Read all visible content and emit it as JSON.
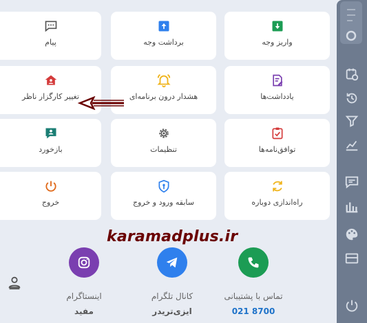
{
  "tiles": {
    "deposit": "واریز وجه",
    "withdraw": "برداشت وجه",
    "message": "پیام",
    "notes": "یادداشت‌ها",
    "in_app_alert": "هشدار درون برنامه‌ای",
    "change_supervisor": "تغییر کارگزار ناظر",
    "agreements": "توافق‌نامه‌ها",
    "settings": "تنظیمات",
    "feedback": "بازخورد",
    "restart": "راه‌اندازی دوباره",
    "login_history": "سابقه ورود و خروج",
    "logout": "خروج"
  },
  "watermark": "karamadplus.ir",
  "contacts": {
    "support_title": "تماس با پشتیبانی",
    "support_phone": "021 8700",
    "telegram_title": "کانال تلگرام",
    "telegram_value": "ایزی‌تریدر",
    "instagram_title": "اینستاگرام",
    "instagram_value": "مفید"
  },
  "colors": {
    "green": "#1c9c54",
    "blue": "#2f80ed",
    "teal": "#1b7e74",
    "red": "#d43b3b",
    "orange": "#e06a1b",
    "purple": "#7a3fb0",
    "yellow": "#f0b41c",
    "gray": "#555555",
    "sidebar": "#6e7b8f",
    "arrow": "#6a0000"
  },
  "sidebar_icons": [
    "logo-icon",
    "calendar-icon",
    "history-icon",
    "filter-icon",
    "chart-icon",
    "chat-icon",
    "bars-chart-icon",
    "palette-icon",
    "layout-icon",
    "user-icon",
    "power-icon"
  ]
}
